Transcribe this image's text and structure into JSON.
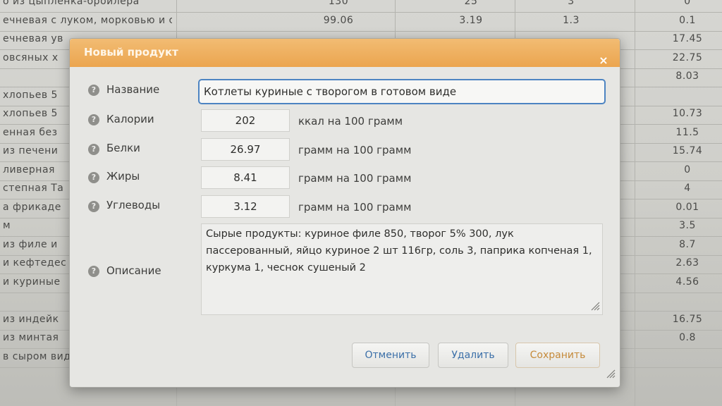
{
  "background_table": {
    "rows": [
      {
        "name": "о из цыпленка-бройлера",
        "c1": "130",
        "c2": "25",
        "c3": "3",
        "c4": "0"
      },
      {
        "name": "ечневая с луком, морковью и соевым",
        "c1": "99.06",
        "c2": "3.19",
        "c3": "1.3",
        "c4": "0.1"
      },
      {
        "name": "ечневая ув",
        "c1": "",
        "c2": "",
        "c3": "",
        "c4": "17.45"
      },
      {
        "name": "овсяных х",
        "c1": "",
        "c2": "",
        "c3": "",
        "c4": "22.75"
      },
      {
        "name": "",
        "c1": "",
        "c2": "",
        "c3": "",
        "c4": "8.03"
      },
      {
        "name": "хлопьев 5",
        "c1": "",
        "c2": "",
        "c3": "",
        "c4": ""
      },
      {
        "name": "хлопьев 5",
        "c1": "",
        "c2": "",
        "c3": "",
        "c4": "10.73"
      },
      {
        "name": "енная без",
        "c1": "",
        "c2": "",
        "c3": "",
        "c4": "11.5"
      },
      {
        "name": "из печени",
        "c1": "",
        "c2": "",
        "c3": "",
        "c4": "15.74"
      },
      {
        "name": "ливерная",
        "c1": "",
        "c2": "",
        "c3": "",
        "c4": "0"
      },
      {
        "name": "степная Та",
        "c1": "",
        "c2": "",
        "c3": "",
        "c4": "4"
      },
      {
        "name": "а фрикаде",
        "c1": "",
        "c2": "",
        "c3": "",
        "c4": "0.01"
      },
      {
        "name": "м",
        "c1": "",
        "c2": "",
        "c3": "",
        "c4": "3.5"
      },
      {
        "name": "из филе и",
        "c1": "",
        "c2": "",
        "c3": "",
        "c4": "8.7"
      },
      {
        "name": "и кефтедес",
        "c1": "",
        "c2": "",
        "c3": "",
        "c4": "2.63"
      },
      {
        "name": "и куриные",
        "c1": "",
        "c2": "",
        "c3": "",
        "c4": "4.56"
      },
      {
        "name": "",
        "c1": "",
        "c2": "",
        "c3": "",
        "c4": ""
      },
      {
        "name": "из индейк",
        "c1": "",
        "c2": "",
        "c3": "",
        "c4": "16.75"
      },
      {
        "name": "из минтая",
        "c1": "",
        "c2": "",
        "c3": "",
        "c4": "0.8"
      },
      {
        "name": "в сыром виде",
        "c1": "",
        "c2": "",
        "c3": "",
        "c4": ""
      }
    ]
  },
  "dialog": {
    "title": "Новый продукт",
    "close_glyph": "×",
    "help_glyph": "?",
    "fields": {
      "name": {
        "label": "Название",
        "value": "Котлеты куриные с творогом в готовом виде"
      },
      "calories": {
        "label": "Калории",
        "value": "202",
        "unit": "ккал на 100 грамм"
      },
      "protein": {
        "label": "Белки",
        "value": "26.97",
        "unit": "грамм на 100 грамм"
      },
      "fat": {
        "label": "Жиры",
        "value": "8.41",
        "unit": "грамм на 100 грамм"
      },
      "carbs": {
        "label": "Углеводы",
        "value": "3.12",
        "unit": "грамм на 100 грамм"
      },
      "description": {
        "label": "Описание",
        "value": "Сырые продукты: куриное филе 850, творог 5% 300, лук пассерованный, яйцо куриное 2 шт 116гр, соль 3, паприка копченая 1, куркума 1, чеснок сушеный 2"
      }
    },
    "buttons": {
      "cancel": "Отменить",
      "delete": "Удалить",
      "save": "Сохранить"
    }
  }
}
